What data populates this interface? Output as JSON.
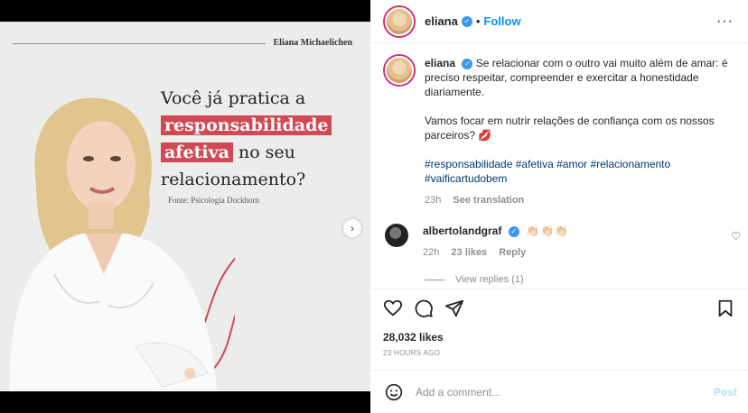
{
  "image": {
    "author": "Eliana Michaelichen",
    "headline_pre": "Você já pratica a",
    "headline_hl1": "responsabilidade",
    "headline_hl2": "afetiva",
    "headline_mid": " no seu",
    "headline_post": "relacionamento?",
    "source": "Fonte: Psicologia Dockhorn",
    "accent": "#cf4a55"
  },
  "header": {
    "username": "eliana",
    "separator": "•",
    "follow_label": "Follow",
    "more_label": "···"
  },
  "caption": {
    "username": "eliana",
    "text1": "Se relacionar com o outro vai muito além de amar: é preciso respeitar, compreender e exercitar a honestidade diariamente.",
    "text2": "Vamos focar em nutrir relações de confiança com os nossos parceiros? 💋",
    "hashtags": "#responsabilidade #afetiva #amor #relacionamento #vaificartudobem",
    "time": "23h",
    "see_translation": "See translation"
  },
  "comment": {
    "username": "albertolandgraf",
    "emojis": "👏🏻👏🏻👏🏻",
    "time": "22h",
    "likes": "23 likes",
    "reply": "Reply",
    "view_replies": "View replies (1)"
  },
  "actions": {
    "likes": "28,032 likes",
    "ago": "23 HOURS AGO"
  },
  "add_comment": {
    "placeholder": "Add a comment...",
    "post_label": "Post"
  }
}
